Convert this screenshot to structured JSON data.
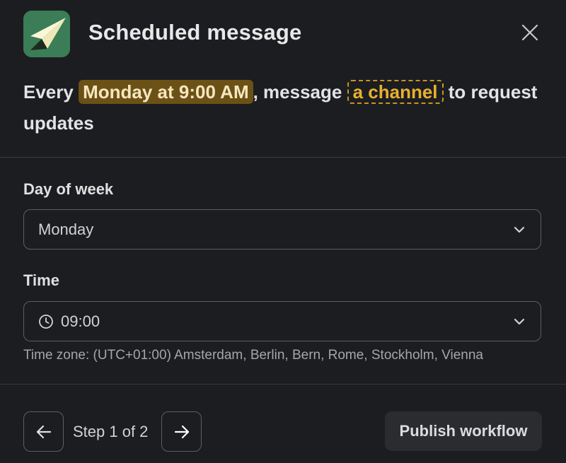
{
  "header": {
    "title": "Scheduled message",
    "app_icon": "paper-plane-icon",
    "close_icon": "close-icon"
  },
  "summary": {
    "prefix": "Every",
    "time_token": "Monday at 9:00 AM",
    "middle": ", message",
    "channel_token": "a channel",
    "suffix": "to request updates"
  },
  "fields": {
    "day_of_week": {
      "label": "Day of week",
      "value": "Monday"
    },
    "time": {
      "label": "Time",
      "value": "09:00",
      "timezone_hint": "Time zone: (UTC+01:00) Amsterdam, Berlin, Bern, Rome, Stockholm, Vienna"
    }
  },
  "footer": {
    "step_text": "Step 1 of 2",
    "publish_label": "Publish workflow"
  },
  "colors": {
    "background": "#1c1d21",
    "highlight_bg": "#6b5115",
    "channel_accent": "#e8b030",
    "app_icon_bg": "#3a7d57"
  }
}
